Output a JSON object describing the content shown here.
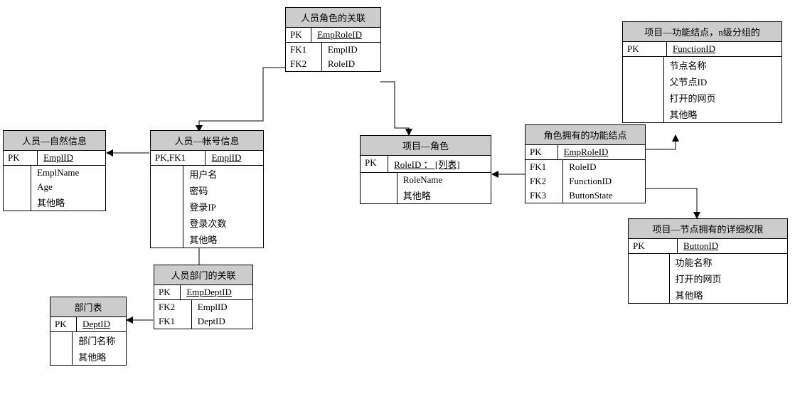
{
  "entities": {
    "empRole": {
      "title": "人员角色的关联",
      "pkLabel": "PK",
      "pkField": "EmpRoleID",
      "rows": [
        {
          "k": "FK1",
          "v": "EmplID"
        },
        {
          "k": "FK2",
          "v": "RoleID"
        }
      ]
    },
    "empNatural": {
      "title": "人员—自然信息",
      "pkLabel": "PK",
      "pkField": "EmplID",
      "rows": [
        {
          "k": "",
          "v": "EmplName"
        },
        {
          "k": "",
          "v": "Age"
        },
        {
          "k": "",
          "v": "其他略"
        }
      ]
    },
    "empAccount": {
      "title": "人员—帐号信息",
      "pkLabel": "PK,FK1",
      "pkField": "EmplID",
      "rows": [
        {
          "k": "",
          "v": "用户名"
        },
        {
          "k": "",
          "v": "密码"
        },
        {
          "k": "",
          "v": "登录IP"
        },
        {
          "k": "",
          "v": "登录次数"
        },
        {
          "k": "",
          "v": "其他略"
        }
      ]
    },
    "projectRole": {
      "title": "项目—角色",
      "pkLabel": "PK",
      "pkField": "RoleID ： [列表]",
      "rows": [
        {
          "k": "",
          "v": "RoleName"
        },
        {
          "k": "",
          "v": "其他略"
        }
      ]
    },
    "roleFunc": {
      "title": "角色拥有的功能结点",
      "pkLabel": "PK",
      "pkField": "EmpRoleID",
      "rows": [
        {
          "k": "FK1",
          "v": "RoleID"
        },
        {
          "k": "FK2",
          "v": "FunctionID"
        },
        {
          "k": "FK3",
          "v": "ButtonState"
        }
      ]
    },
    "projectFunc": {
      "title": "项目—功能结点，n级分组的",
      "pkLabel": "PK",
      "pkField": "FunctionID",
      "rows": [
        {
          "k": "",
          "v": "节点名称"
        },
        {
          "k": "",
          "v": "父节点ID"
        },
        {
          "k": "",
          "v": "打开的网页"
        },
        {
          "k": "",
          "v": "其他略"
        }
      ]
    },
    "nodePerm": {
      "title": "项目—节点拥有的详细权限",
      "pkLabel": "PK",
      "pkField": "ButtonID",
      "rows": [
        {
          "k": "",
          "v": "功能名称"
        },
        {
          "k": "",
          "v": "打开的网页"
        },
        {
          "k": "",
          "v": "其他略"
        }
      ]
    },
    "empDept": {
      "title": "人员部门的关联",
      "pkLabel": "PK",
      "pkField": "EmpDeptID",
      "rows": [
        {
          "k": "FK2",
          "v": "EmplID"
        },
        {
          "k": "FK1",
          "v": "DeptID"
        }
      ]
    },
    "dept": {
      "title": "部门表",
      "pkLabel": "PK",
      "pkField": "DeptID",
      "rows": [
        {
          "k": "",
          "v": "部门名称"
        },
        {
          "k": "",
          "v": "其他略"
        }
      ]
    }
  }
}
